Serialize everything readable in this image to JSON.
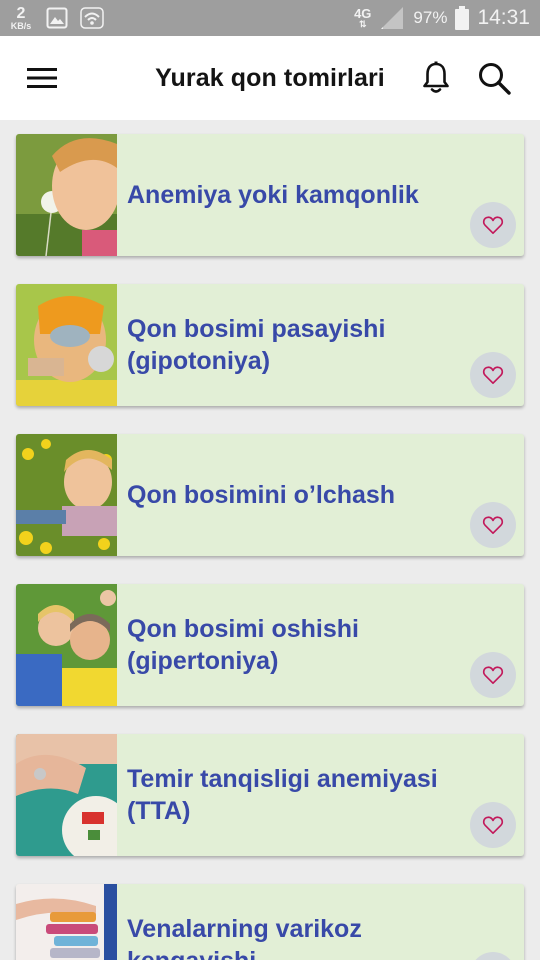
{
  "status_bar": {
    "speed_value": "2",
    "speed_unit": "KB/s",
    "network": "4G",
    "battery": "97%",
    "time": "14:31"
  },
  "app_bar": {
    "title": "Yurak qon tomirlari",
    "menu_icon": "menu-icon",
    "bell_icon": "bell-icon",
    "search_icon": "search-icon"
  },
  "colors": {
    "card_bg": "#e2efd6",
    "title_color": "#3849a8",
    "heart_color": "#c2185b",
    "fav_bg": "#d2d8dc"
  },
  "articles": [
    {
      "title": "Anemiya yoki kamqonlik",
      "image": "child-with-dandelion-photo"
    },
    {
      "title": "Qon bosimi pasayishi (gipotoniya)",
      "image": "man-in-gas-mask-photo"
    },
    {
      "title": "Qon bosimini o’lchash",
      "image": "boy-in-flowers-photo"
    },
    {
      "title": "Qon bosimi oshishi (gipertoniya)",
      "image": "family-on-grass-photo"
    },
    {
      "title": "Temir tanqisligi anemiyasi (TTA)",
      "image": "hand-with-food-photo"
    },
    {
      "title": "Venalarning varikoz kengayishi",
      "image": "pills-in-hand-photo"
    }
  ]
}
